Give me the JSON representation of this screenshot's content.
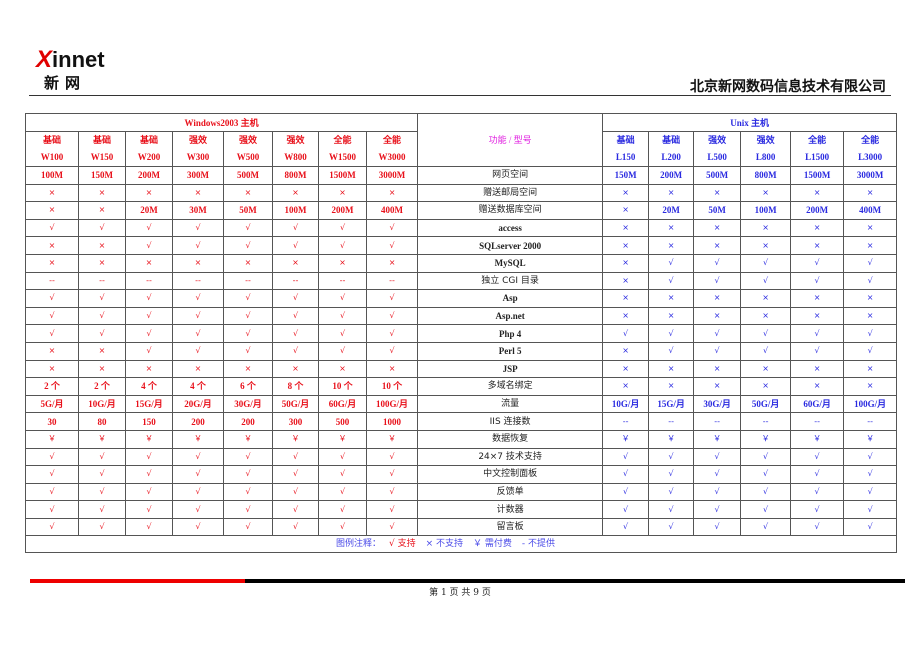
{
  "header": {
    "logo_text_x": "X",
    "logo_text_rest": "innet",
    "logo_cn": "新网",
    "company": "北京新网数码信息技术有限公司"
  },
  "table": {
    "windows_group": "Windows2003 主机",
    "unix_group": "Unix 主机",
    "feature_header": "功能 / 型号",
    "windows_plans": [
      {
        "tier": "基础",
        "model": "W100"
      },
      {
        "tier": "基础",
        "model": "W150"
      },
      {
        "tier": "基础",
        "model": "W200"
      },
      {
        "tier": "强效",
        "model": "W300"
      },
      {
        "tier": "强效",
        "model": "W500"
      },
      {
        "tier": "强效",
        "model": "W800"
      },
      {
        "tier": "全能",
        "model": "W1500"
      },
      {
        "tier": "全能",
        "model": "W3000"
      }
    ],
    "unix_plans": [
      {
        "tier": "基础",
        "model": "L150"
      },
      {
        "tier": "基础",
        "model": "L200"
      },
      {
        "tier": "强效",
        "model": "L500"
      },
      {
        "tier": "强效",
        "model": "L800"
      },
      {
        "tier": "全能",
        "model": "L1500"
      },
      {
        "tier": "全能",
        "model": "L3000"
      }
    ],
    "rows": [
      {
        "feature": "网页空间",
        "win": [
          "100M",
          "150M",
          "200M",
          "300M",
          "500M",
          "800M",
          "1500M",
          "3000M"
        ],
        "unix": [
          "150M",
          "200M",
          "500M",
          "800M",
          "1500M",
          "3000M"
        ]
      },
      {
        "feature": "赠送邮局空间",
        "win": [
          "×",
          "×",
          "×",
          "×",
          "×",
          "×",
          "×",
          "×"
        ],
        "unix": [
          "×",
          "×",
          "×",
          "×",
          "×",
          "×"
        ]
      },
      {
        "feature": "赠送数据库空间",
        "win": [
          "×",
          "×",
          "20M",
          "30M",
          "50M",
          "100M",
          "200M",
          "400M"
        ],
        "unix": [
          "×",
          "20M",
          "50M",
          "100M",
          "200M",
          "400M"
        ]
      },
      {
        "feature": "access",
        "win": [
          "√",
          "√",
          "√",
          "√",
          "√",
          "√",
          "√",
          "√"
        ],
        "unix": [
          "×",
          "×",
          "×",
          "×",
          "×",
          "×"
        ]
      },
      {
        "feature": "SQLserver 2000",
        "win": [
          "×",
          "×",
          "√",
          "√",
          "√",
          "√",
          "√",
          "√"
        ],
        "unix": [
          "×",
          "×",
          "×",
          "×",
          "×",
          "×"
        ]
      },
      {
        "feature": "MySQL",
        "win": [
          "×",
          "×",
          "×",
          "×",
          "×",
          "×",
          "×",
          "×"
        ],
        "unix": [
          "×",
          "√",
          "√",
          "√",
          "√",
          "√"
        ]
      },
      {
        "feature": "独立 CGI 目录",
        "win": [
          "--",
          "--",
          "--",
          "--",
          "--",
          "--",
          "--",
          "--"
        ],
        "unix": [
          "×",
          "√",
          "√",
          "√",
          "√",
          "√"
        ]
      },
      {
        "feature": "Asp",
        "win": [
          "√",
          "√",
          "√",
          "√",
          "√",
          "√",
          "√",
          "√"
        ],
        "unix": [
          "×",
          "×",
          "×",
          "×",
          "×",
          "×"
        ]
      },
      {
        "feature": "Asp.net",
        "win": [
          "√",
          "√",
          "√",
          "√",
          "√",
          "√",
          "√",
          "√"
        ],
        "unix": [
          "×",
          "×",
          "×",
          "×",
          "×",
          "×"
        ]
      },
      {
        "feature": "Php 4",
        "win": [
          "√",
          "√",
          "√",
          "√",
          "√",
          "√",
          "√",
          "√"
        ],
        "unix": [
          "√",
          "√",
          "√",
          "√",
          "√",
          "√"
        ]
      },
      {
        "feature": "Perl 5",
        "win": [
          "×",
          "×",
          "√",
          "√",
          "√",
          "√",
          "√",
          "√"
        ],
        "unix": [
          "×",
          "√",
          "√",
          "√",
          "√",
          "√"
        ]
      },
      {
        "feature": "JSP",
        "win": [
          "×",
          "×",
          "×",
          "×",
          "×",
          "×",
          "×",
          "×"
        ],
        "unix": [
          "×",
          "×",
          "×",
          "×",
          "×",
          "×"
        ]
      },
      {
        "feature": "多域名绑定",
        "win": [
          "2 个",
          "2 个",
          "4 个",
          "4 个",
          "6 个",
          "8 个",
          "10 个",
          "10 个"
        ],
        "unix": [
          "×",
          "×",
          "×",
          "×",
          "×",
          "×"
        ]
      },
      {
        "feature": "流量",
        "win": [
          "5G/月",
          "10G/月",
          "15G/月",
          "20G/月",
          "30G/月",
          "50G/月",
          "60G/月",
          "100G/月"
        ],
        "unix": [
          "10G/月",
          "15G/月",
          "30G/月",
          "50G/月",
          "60G/月",
          "100G/月"
        ]
      },
      {
        "feature": "IIS 连接数",
        "win": [
          "30",
          "80",
          "150",
          "200",
          "200",
          "300",
          "500",
          "1000"
        ],
        "unix": [
          "--",
          "--",
          "--",
          "--",
          "--",
          "--"
        ]
      },
      {
        "feature": "数据恢复",
        "win": [
          "￥",
          "￥",
          "￥",
          "￥",
          "￥",
          "￥",
          "￥",
          "￥"
        ],
        "unix": [
          "￥",
          "￥",
          "￥",
          "￥",
          "￥",
          "￥"
        ]
      },
      {
        "feature": "24×7 技术支持",
        "win": [
          "√",
          "√",
          "√",
          "√",
          "√",
          "√",
          "√",
          "√"
        ],
        "unix": [
          "√",
          "√",
          "√",
          "√",
          "√",
          "√"
        ]
      },
      {
        "feature": "中文控制面板",
        "win": [
          "√",
          "√",
          "√",
          "√",
          "√",
          "√",
          "√",
          "√"
        ],
        "unix": [
          "√",
          "√",
          "√",
          "√",
          "√",
          "√"
        ]
      },
      {
        "feature": "反馈单",
        "win": [
          "√",
          "√",
          "√",
          "√",
          "√",
          "√",
          "√",
          "√"
        ],
        "unix": [
          "√",
          "√",
          "√",
          "√",
          "√",
          "√"
        ]
      },
      {
        "feature": "计数器",
        "win": [
          "√",
          "√",
          "√",
          "√",
          "√",
          "√",
          "√",
          "√"
        ],
        "unix": [
          "√",
          "√",
          "√",
          "√",
          "√",
          "√"
        ]
      },
      {
        "feature": "留言板",
        "win": [
          "√",
          "√",
          "√",
          "√",
          "√",
          "√",
          "√",
          "√"
        ],
        "unix": [
          "√",
          "√",
          "√",
          "√",
          "√",
          "√"
        ]
      }
    ],
    "legend": {
      "label": "图例注释：",
      "supported": "√ 支持",
      "not_supported": "× 不支持",
      "paid": "￥ 需付费",
      "not_provided": "- 不提供"
    }
  },
  "colors": {
    "windows": "#e8101a",
    "unix": "#2a2ae0",
    "feature_header": "#e020e0"
  },
  "footer": {
    "page_indicator": "第 1 页 共 9 页"
  }
}
